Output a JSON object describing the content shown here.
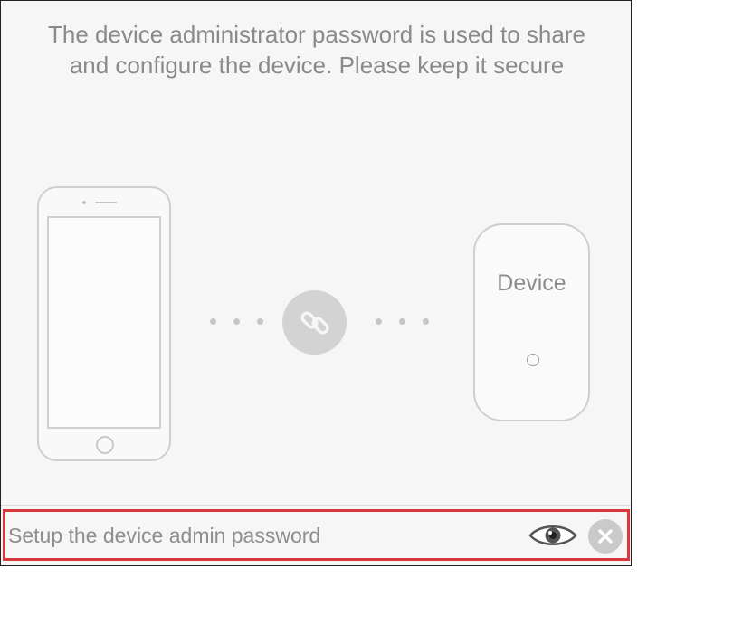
{
  "description": {
    "line1": "The device administrator password is used to share",
    "line2": "and configure the device. Please keep it secure"
  },
  "illustration": {
    "device_label": "Device"
  },
  "password_field": {
    "placeholder": "Setup the device admin password",
    "value": ""
  },
  "icons": {
    "show_password": "eye-icon",
    "clear": "close-icon",
    "link": "link-icon"
  },
  "colors": {
    "highlight_border": "#d9363e",
    "background": "#f6f6f6",
    "text": "#8a8a8a"
  }
}
